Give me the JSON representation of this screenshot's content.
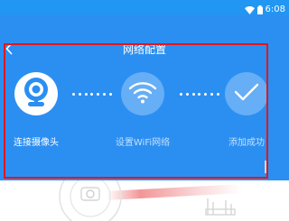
{
  "status_bar": {
    "time": "6:08",
    "icons": [
      "wifi-icon",
      "battery-icon"
    ]
  },
  "header": {
    "title": "网络配置",
    "back_icon": "back-arrow-icon"
  },
  "steps": [
    {
      "label": "连接摄像头",
      "icon": "camera-icon",
      "state": "active"
    },
    {
      "label": "设置WiFi网络",
      "icon": "wifi-icon",
      "state": "inactive"
    },
    {
      "label": "添加成功",
      "icon": "check-icon",
      "state": "inactive"
    }
  ],
  "colors": {
    "primary": "#2b8ff2",
    "status_bar": "#2196f3",
    "highlight": "#e3161b",
    "white": "#ffffff"
  }
}
